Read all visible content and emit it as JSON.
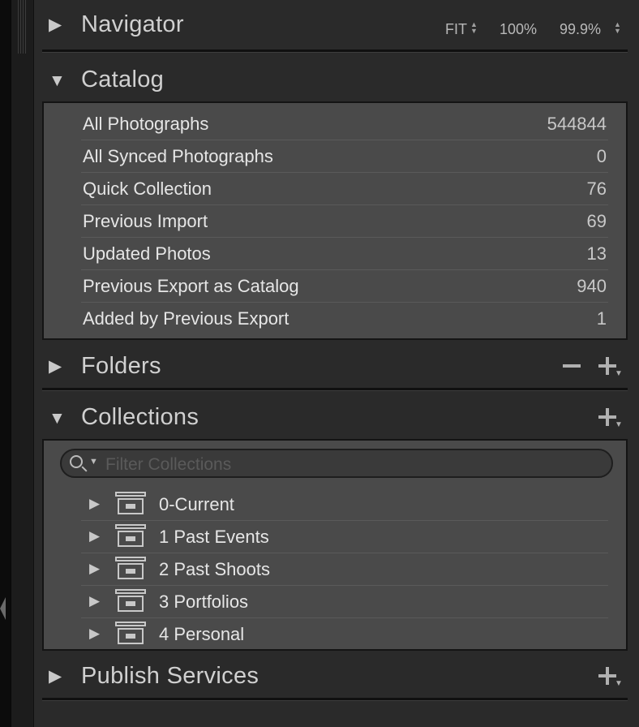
{
  "navigator": {
    "title": "Navigator",
    "zoom_fit": "FIT",
    "zoom_100": "100%",
    "zoom_custom": "99.9%"
  },
  "catalog": {
    "title": "Catalog",
    "items": [
      {
        "label": "All Photographs",
        "count": "544844"
      },
      {
        "label": "All Synced Photographs",
        "count": "0"
      },
      {
        "label": "Quick Collection",
        "count": "76"
      },
      {
        "label": "Previous Import",
        "count": "69"
      },
      {
        "label": "Updated Photos",
        "count": "13"
      },
      {
        "label": "Previous Export as Catalog",
        "count": "940"
      },
      {
        "label": "Added by Previous Export",
        "count": "1"
      }
    ]
  },
  "folders": {
    "title": "Folders"
  },
  "collections": {
    "title": "Collections",
    "filter_placeholder": "Filter Collections",
    "items": [
      {
        "label": "0-Current"
      },
      {
        "label": "1 Past Events"
      },
      {
        "label": "2 Past Shoots"
      },
      {
        "label": "3 Portfolios"
      },
      {
        "label": "4 Personal"
      }
    ]
  },
  "publish_services": {
    "title": "Publish Services"
  },
  "icons": {
    "expand": "triangle-right-icon",
    "collapse": "triangle-down-icon",
    "add": "plus-icon",
    "remove": "minus-icon",
    "search": "magnifier-icon",
    "collection_set": "collection-set-box-icon"
  },
  "colors": {
    "panel_bg": "#2a2a2a",
    "list_bg": "#4a4a4a",
    "text": "#e6e6e6"
  }
}
